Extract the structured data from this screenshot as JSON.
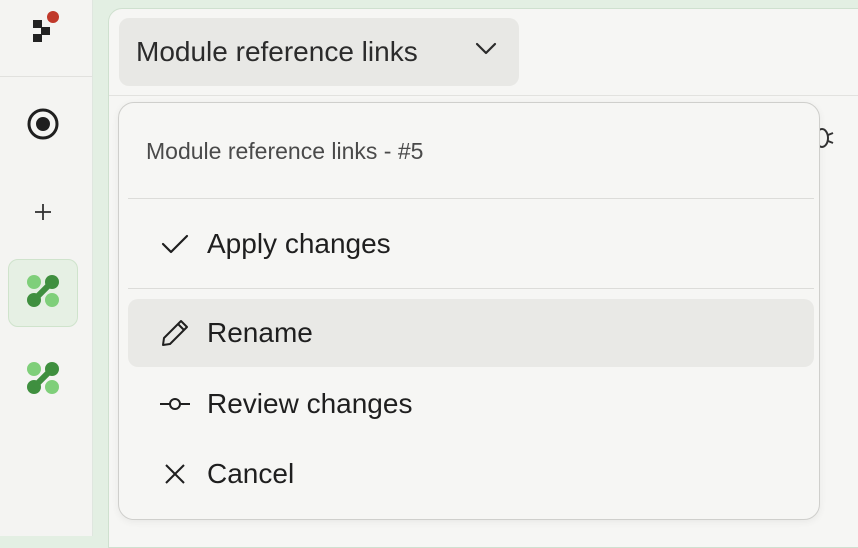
{
  "sidebar": {
    "items": [
      {
        "name": "record",
        "icon": "record-icon"
      },
      {
        "name": "add",
        "icon": "plus-icon"
      },
      {
        "name": "workflow-active",
        "icon": "workflow-icon"
      },
      {
        "name": "workflow",
        "icon": "workflow-icon"
      }
    ]
  },
  "header": {
    "module_select_label": "Module reference links"
  },
  "menu": {
    "title": "Module reference links - #5",
    "items": [
      {
        "label": "Apply changes",
        "icon": "check-icon"
      },
      {
        "label": "Rename",
        "icon": "pencil-icon"
      },
      {
        "label": "Review changes",
        "icon": "commit-icon"
      },
      {
        "label": "Cancel",
        "icon": "close-icon"
      }
    ]
  },
  "colors": {
    "accent_green": "#3f8f3f",
    "accent_green_light": "#7fcf7a",
    "logo_red": "#c0392b"
  }
}
